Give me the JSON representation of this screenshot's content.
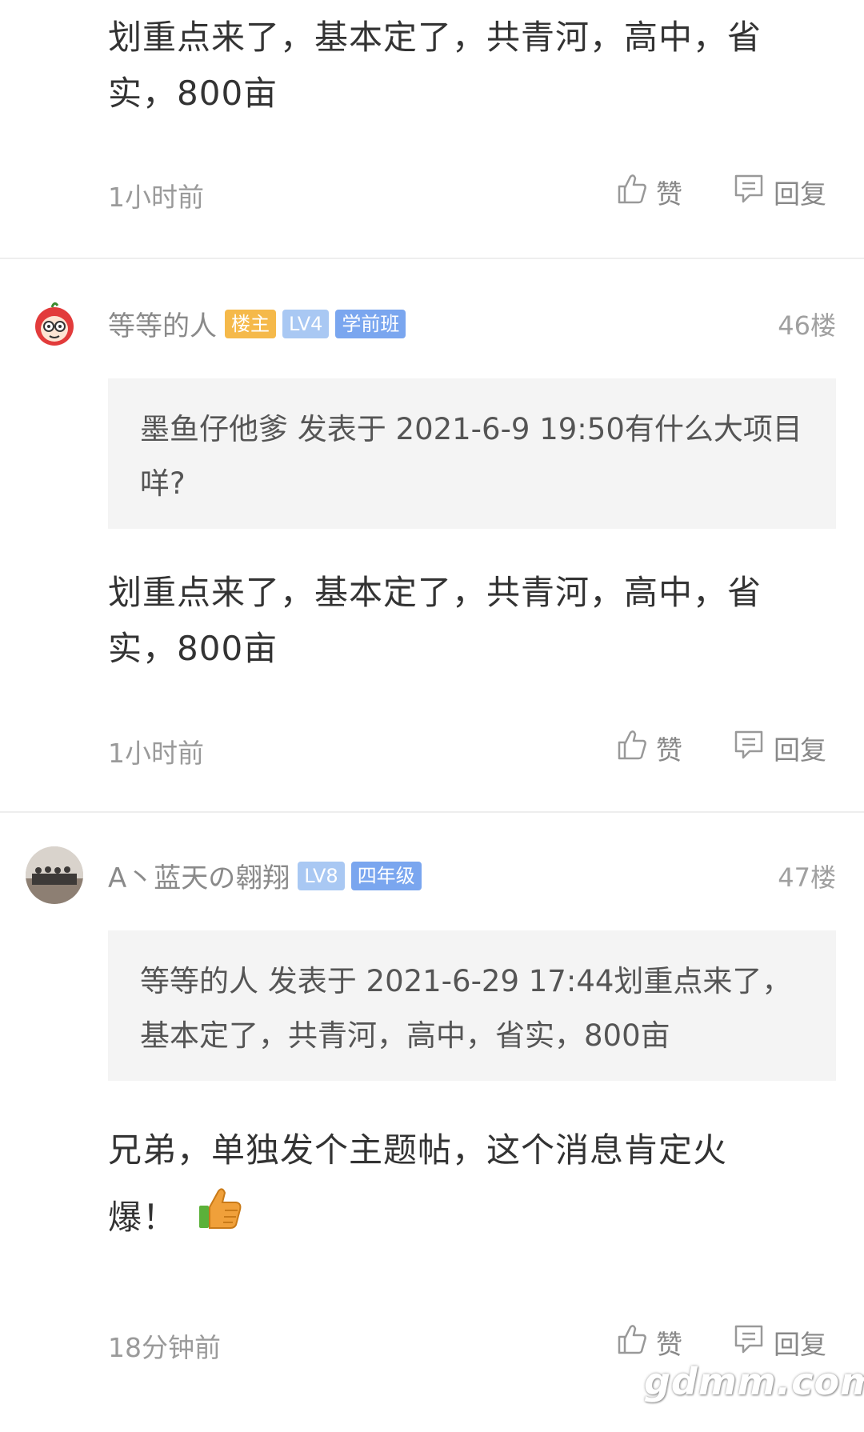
{
  "posts": [
    {
      "content": "划重点来了，基本定了，共青河，高中，省实，800亩",
      "time": "1小时前",
      "like_label": "赞",
      "reply_label": "回复"
    },
    {
      "username": "等等的人",
      "badges": [
        {
          "text": "楼主",
          "color": "#f5b94a"
        },
        {
          "text": "LV4",
          "color": "#a9c8f3"
        },
        {
          "text": "学前班",
          "color": "#7aa6ef"
        }
      ],
      "floor": "46楼",
      "quote": "墨鱼仔他爹 发表于 2021-6-9 19:50有什么大项目咩?",
      "content": "划重点来了，基本定了，共青河，高中，省实，800亩",
      "time": "1小时前",
      "like_label": "赞",
      "reply_label": "回复"
    },
    {
      "username": "A丶蓝天の翱翔",
      "badges": [
        {
          "text": "LV8",
          "color": "#a9c8f3"
        },
        {
          "text": "四年级",
          "color": "#7aa6ef"
        }
      ],
      "floor": "47楼",
      "quote": "等等的人 发表于 2021-6-29 17:44划重点来了，基本定了，共青河，高中，省实，800亩",
      "content": "兄弟，单独发个主题帖，这个消息肯定火爆！",
      "emoji": "thumbs-up-emoji",
      "time": "18分钟前",
      "like_label": "赞",
      "reply_label": "回复"
    }
  ],
  "watermark": "gdmm.com"
}
